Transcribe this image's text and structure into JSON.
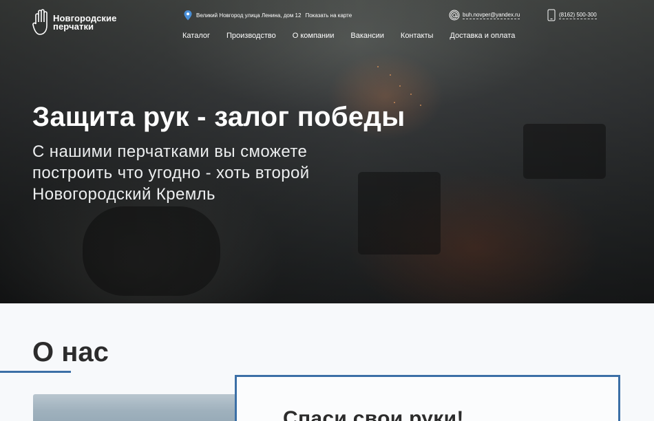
{
  "header": {
    "logo_line1": "Новгородские",
    "logo_line2": "перчатки",
    "address": "Великий Новгород улица Ленина, дом 12",
    "map_link": "Показать на карте",
    "email": "buh.novper@yandex.ru",
    "phone": "(8162) 500-300",
    "nav": [
      "Каталог",
      "Производство",
      "О компании",
      "Вакансии",
      "Контакты",
      "Доставка и оплата"
    ]
  },
  "hero": {
    "title": "Защита рук - залог победы",
    "subtitle": "С нашими перчатками вы сможете построить что угодно - хоть второй Новогородский Кремль"
  },
  "about": {
    "title": "О нас",
    "card_title": "Спаси свои руки!"
  },
  "icons": [
    "hand-logo-icon",
    "map-pin-icon",
    "at-sign-icon",
    "smartphone-icon"
  ],
  "colors": {
    "accent": "#3b6fa6",
    "pin": "#4a90d9"
  }
}
